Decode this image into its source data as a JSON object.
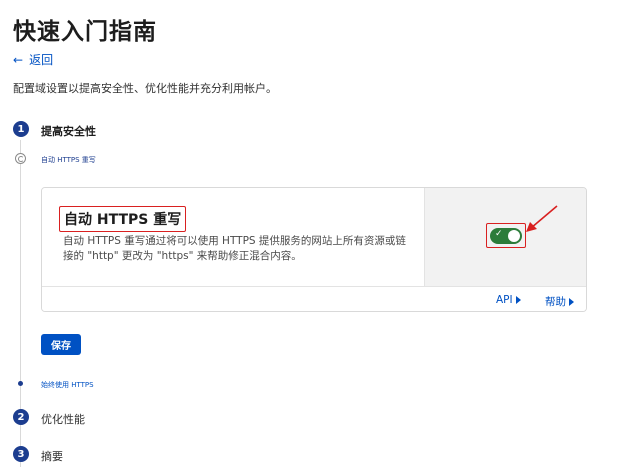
{
  "page": {
    "title": "快速入门指南",
    "back_label": "返回",
    "description": "配置域设置以提高安全性、优化性能并充分利用帐户。"
  },
  "steps": [
    {
      "number": "1",
      "label": "提高安全性"
    },
    {
      "number": "2",
      "label": "优化性能"
    },
    {
      "number": "3",
      "label": "摘要"
    }
  ],
  "substeps": {
    "current": "自动 HTTPS 重写",
    "next": "始终使用 HTTPS"
  },
  "setting_card": {
    "title": "自动 HTTPS 重写",
    "description": "自动 HTTPS 重写通过将可以使用 HTTPS 提供服务的网站上所有资源或链接的 \"http\" 更改为 \"https\" 来帮助修正混合内容。",
    "toggle_on": true,
    "toggle_check": "✓",
    "api_link": "API",
    "help_link": "帮助"
  },
  "save_label": "保存",
  "colors": {
    "accent": "#0051c3",
    "step_fill": "#1c3d8f",
    "toggle_on": "#2c7c3a",
    "annotation_red": "#d92020"
  },
  "icons": {
    "back": "arrow-left-icon",
    "substep_current": "half-circle-progress-icon",
    "link_caret": "caret-right-icon",
    "toggle_check": "check-icon"
  }
}
